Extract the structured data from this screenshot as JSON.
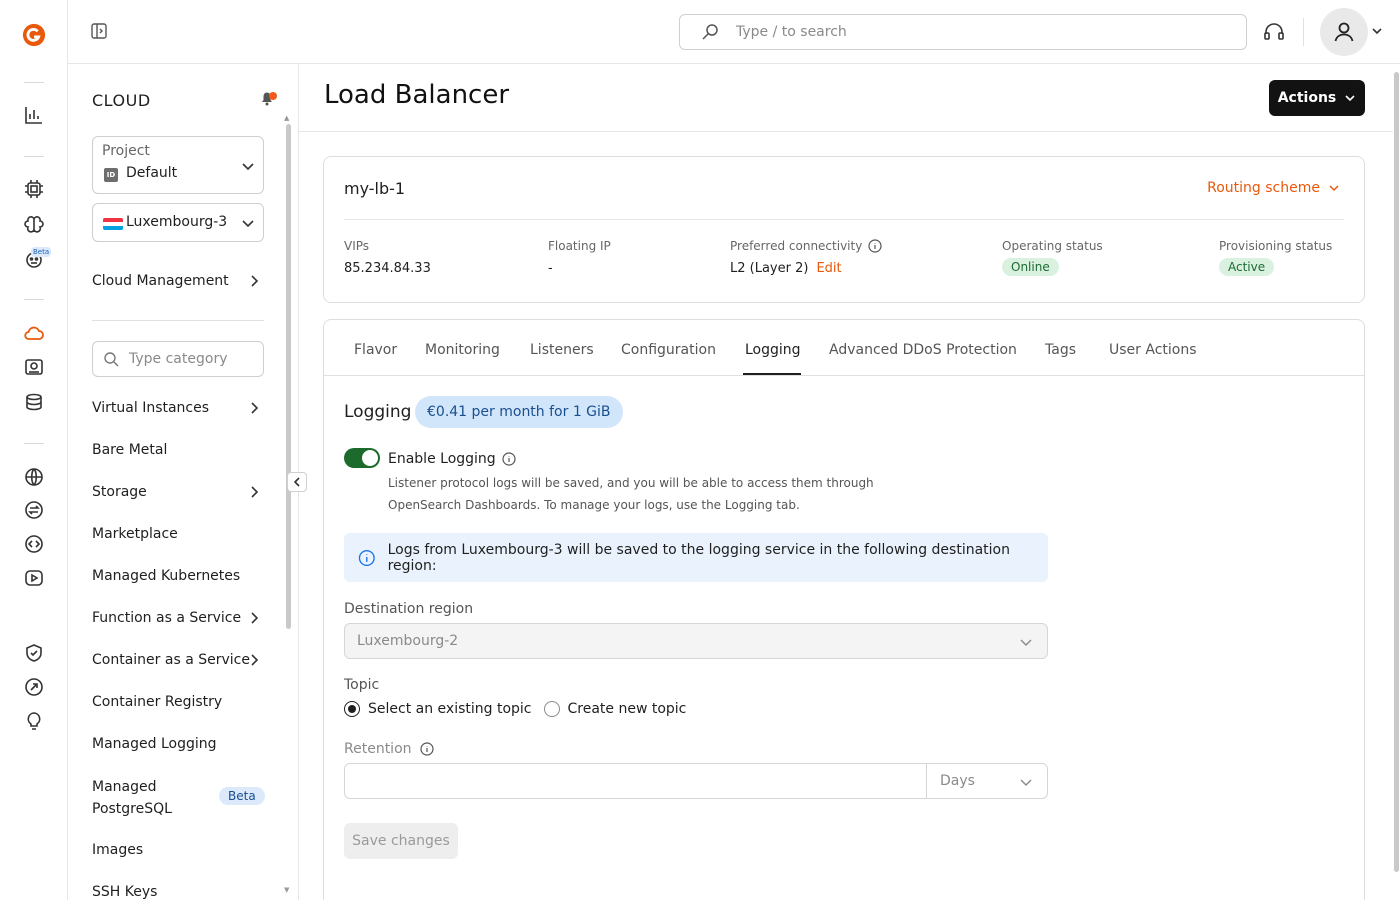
{
  "app": {
    "logo_icon": "brand-logo-icon",
    "accent_color": "#e8590c"
  },
  "rail": {
    "beta_label": "Beta",
    "icons": [
      "analytics-icon",
      "cpu-icon",
      "brain-icon",
      "robot-icon",
      "cloud-icon",
      "storage-icon",
      "database-icon",
      "globe-icon",
      "exchange-icon",
      "code-icon",
      "streaming-icon",
      "shield-icon",
      "rocket-icon",
      "lightbulb-icon"
    ]
  },
  "topbar": {
    "search_placeholder": "Type / to search"
  },
  "sidenav": {
    "title": "CLOUD",
    "project": {
      "label": "Project",
      "id_badge": "ID",
      "value": "Default"
    },
    "region": {
      "value": "Luxembourg-3"
    },
    "cloud_management": "Cloud Management",
    "category_placeholder": "Type category",
    "items": [
      {
        "label": "Virtual Instances",
        "has_children": true
      },
      {
        "label": "Bare Metal",
        "has_children": false
      },
      {
        "label": "Storage",
        "has_children": true
      },
      {
        "label": "Marketplace",
        "has_children": false
      },
      {
        "label": "Managed Kubernetes",
        "has_children": false
      },
      {
        "label": "Function as a Service",
        "has_children": true
      },
      {
        "label": "Container as a Service",
        "has_children": true
      },
      {
        "label": "Container Registry",
        "has_children": false
      },
      {
        "label": "Managed Logging",
        "has_children": false
      },
      {
        "label": "Managed PostgreSQL",
        "has_children": false,
        "badge": "Beta"
      },
      {
        "label": "Images",
        "has_children": false
      },
      {
        "label": "SSH Keys",
        "has_children": false
      }
    ]
  },
  "page": {
    "title": "Load Balancer",
    "actions_label": "Actions"
  },
  "lb": {
    "name": "my-lb-1",
    "routing_label": "Routing scheme",
    "vips_label": "VIPs",
    "vips_value": "85.234.84.33",
    "floating_label": "Floating IP",
    "floating_value": "-",
    "connectivity_label": "Preferred connectivity",
    "connectivity_value": "L2 (Layer 2)",
    "edit_label": "Edit",
    "operating_label": "Operating status",
    "operating_value": "Online",
    "provisioning_label": "Provisioning status",
    "provisioning_value": "Active"
  },
  "tabs": [
    "Flavor",
    "Monitoring",
    "Listeners",
    "Configuration",
    "Logging",
    "Advanced DDoS Protection",
    "Tags",
    "User Actions"
  ],
  "active_tab": "Logging",
  "logging": {
    "title": "Logging",
    "price": "€0.41 per month for 1 GiB",
    "enabled": true,
    "toggle_label": "Enable Logging",
    "desc_line1": "Listener protocol logs will be saved, and you will be able to access them through",
    "desc_line2": "OpenSearch Dashboards. To manage your logs, use the Logging tab.",
    "info_text": "Logs from Luxembourg-3 will be saved to the logging service in the following destination region:",
    "dest_label": "Destination region",
    "dest_value": "Luxembourg-2",
    "topic_label": "Topic",
    "topic_option1": "Select an existing topic",
    "topic_option2": "Create new topic",
    "topic_selected": "Select an existing topic",
    "retention_label": "Retention",
    "retention_value": "",
    "retention_unit": "Days",
    "save_label": "Save changes"
  }
}
